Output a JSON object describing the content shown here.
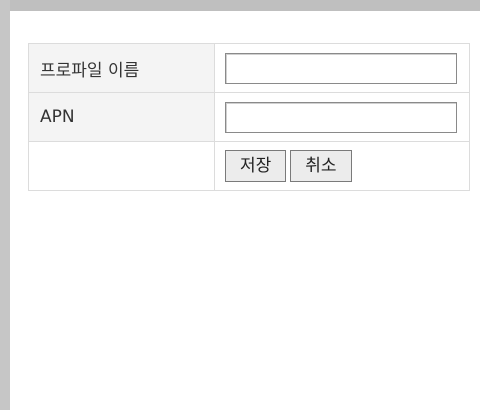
{
  "form": {
    "rows": [
      {
        "label": "프로파일 이름",
        "value": "",
        "placeholder": ""
      },
      {
        "label": "APN",
        "value": "",
        "placeholder": ""
      }
    ],
    "actions": {
      "save_label": "저장",
      "cancel_label": "취소"
    }
  }
}
